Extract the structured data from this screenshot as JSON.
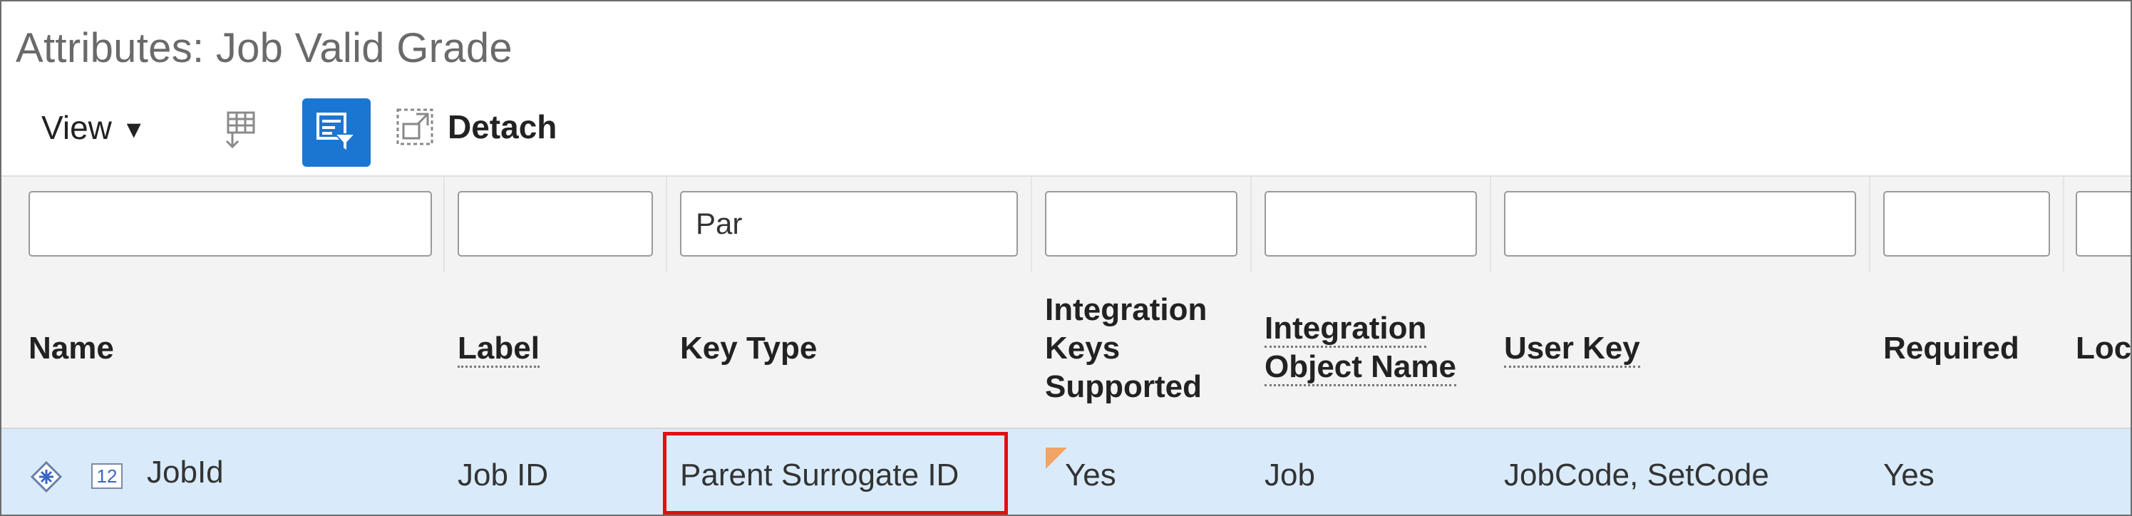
{
  "title": "Attributes: Job Valid Grade",
  "toolbar": {
    "view_label": "View",
    "view_caret": "▼",
    "freeze_icon": "freeze-columns-icon",
    "filter_icon": "query-by-example-icon",
    "detach_icon": "detach-icon",
    "detach_label": "Detach",
    "accent_color": "#1b76d2"
  },
  "filters": {
    "key_type_value": "Par"
  },
  "columns": [
    {
      "label": "Name",
      "underline": false
    },
    {
      "label": "Label",
      "underline": true
    },
    {
      "label": "Key Type",
      "underline": false
    },
    {
      "label": [
        "Integration",
        "Keys",
        "Supported"
      ],
      "underline": false
    },
    {
      "label": [
        "Integration",
        "Object Name"
      ],
      "underline": true
    },
    {
      "label": "User Key",
      "underline": true
    },
    {
      "label": "Required",
      "underline": false
    },
    {
      "label": "Loc",
      "underline": false
    }
  ],
  "rows": [
    {
      "name": "JobId",
      "name_icons": [
        "primary-key-icon",
        "number-type-icon"
      ],
      "number_icon_text": "12",
      "label": "Job ID",
      "key_type": "Parent Surrogate ID",
      "integration_keys_supported": "Yes",
      "integration_object_name": "Job",
      "user_key": "JobCode, SetCode",
      "required": "Yes"
    }
  ],
  "colors": {
    "row_selected": "#d9ebfb",
    "highlight": "#e01010",
    "change_indicator": "#f2a466"
  }
}
